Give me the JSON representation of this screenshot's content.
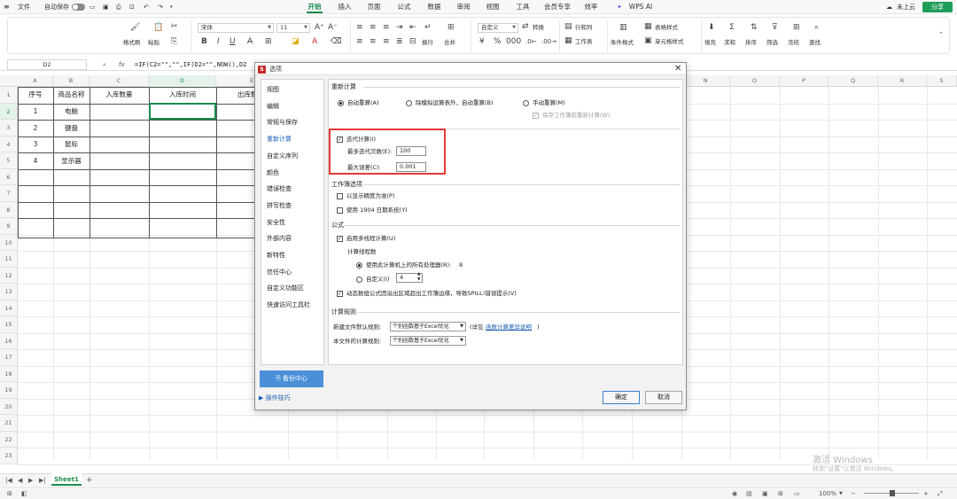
{
  "titlebar": {
    "file_menu": "文件",
    "autosave_label": "自动保存",
    "tabs": [
      "开始",
      "插入",
      "页面",
      "公式",
      "数据",
      "审阅",
      "视图",
      "工具",
      "会员专享",
      "效率"
    ],
    "wps_ai": "WPS AI",
    "cloud_status": "未上云",
    "share": "分享"
  },
  "ribbon": {
    "format_painter": "格式刷",
    "paste": "粘贴",
    "font_name": "宋体",
    "font_size": "11",
    "wrap": "换行",
    "merge": "合并",
    "number_format": "自定义",
    "convert": "转换",
    "rows_cols": "行和列",
    "worksheet": "工作表",
    "conditional_format": "条件格式",
    "table_style": "表格样式",
    "cell_style": "单元格样式",
    "fill": "填充",
    "sum": "求和",
    "sort": "排序",
    "filter": "筛选",
    "freeze": "冻结",
    "find": "查找"
  },
  "formula_bar": {
    "name_box": "D2",
    "fx": "fx",
    "formula": "=IF(C2=\"\",\"\",IF(D2=\"\",NOW(),D2"
  },
  "grid": {
    "columns": [
      "A",
      "B",
      "C",
      "D",
      "E",
      "F",
      "G",
      "H",
      "I",
      "J",
      "K",
      "L",
      "M",
      "N",
      "O",
      "P",
      "Q",
      "R",
      "S"
    ],
    "rows": [
      "1",
      "2",
      "3",
      "4",
      "5",
      "6",
      "7",
      "8",
      "9",
      "10",
      "11",
      "12",
      "13",
      "14",
      "15",
      "16",
      "17",
      "18",
      "19",
      "20",
      "21",
      "22",
      "23"
    ],
    "headers": [
      "序号",
      "商品名称",
      "入库数量",
      "入库时间",
      "出库数"
    ],
    "data": [
      [
        "1",
        "电脑"
      ],
      [
        "2",
        "键盘"
      ],
      [
        "3",
        "鼠标"
      ],
      [
        "4",
        "显示器"
      ]
    ]
  },
  "sheets": {
    "active": "Sheet1",
    "add": "+"
  },
  "status": {
    "zoom": "100%"
  },
  "watermark": {
    "line1": "激活 Windows",
    "line2": "转到\"设置\"以激活 Windows。"
  },
  "dialog": {
    "title": "选项",
    "logo": "S",
    "nav": [
      "视图",
      "编辑",
      "常规与保存",
      "重新计算",
      "自定义序列",
      "颜色",
      "错误检查",
      "拼写检查",
      "安全性",
      "外部内容",
      "新特性",
      "信任中心",
      "自定义功能区",
      "快速访问工具栏"
    ],
    "nav_active_index": 3,
    "recalc": {
      "section": "重新计算",
      "auto": "自动重算(A)",
      "auto_except": "除模拟运算表外，自动重算(B)",
      "manual": "手动重算(M)",
      "save_recalc": "保存工作簿前重新计算(W)",
      "iterative": "迭代计算(I)",
      "max_iter_label": "最多迭代次数(E):",
      "max_iter_value": "100",
      "max_change_label": "最大误差(C):",
      "max_change_value": "0.001"
    },
    "workbook": {
      "section": "工作簿选项",
      "precision": "以显示精度为准(P)",
      "date1904": "使用 1904 日期系统(Y)"
    },
    "formula": {
      "section": "公式",
      "multithread": "启用多线程计算(U)",
      "threads": "计算线程数",
      "all_processors": "使用此计算机上的所有处理器(R):",
      "processor_count": "8",
      "manual_threads": "自定义(I)",
      "manual_value": "4",
      "spill": "动态数组公式因溢出区域超出工作簿边缘，导致SPILL!错误提示(V)"
    },
    "calc_rules": {
      "section": "计算规则",
      "new_file_label": "新建文件默认规则:",
      "new_file_value": "个别函数基于Excel优化",
      "see_prefix": "(详见",
      "see_link": "函数计算差异说明",
      "see_suffix": ")",
      "this_file_label": "本文件的计算规则:",
      "this_file_value": "个别函数基于Excel优化"
    },
    "backup": "备份中心",
    "tips": "操作技巧",
    "ok": "确定",
    "cancel": "取消"
  }
}
